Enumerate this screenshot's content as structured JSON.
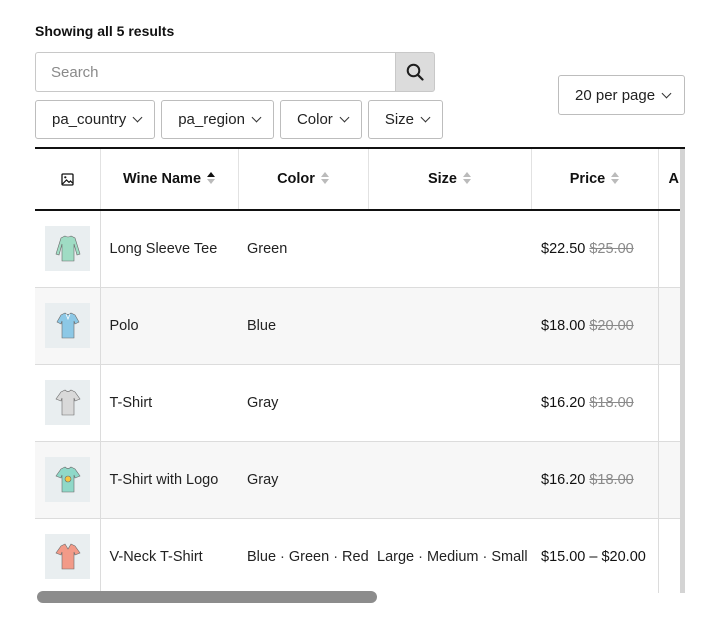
{
  "results_count": "Showing all 5 results",
  "search": {
    "placeholder": "Search",
    "value": ""
  },
  "per_page": {
    "label": "20 per page"
  },
  "filters": [
    {
      "label": "pa_country"
    },
    {
      "label": "pa_region"
    },
    {
      "label": "Color"
    },
    {
      "label": "Size"
    }
  ],
  "table": {
    "columns": [
      {
        "label": "",
        "icon": "image-icon"
      },
      {
        "label": "Wine Name",
        "sort": "ascending"
      },
      {
        "label": "Color",
        "sort": "none"
      },
      {
        "label": "Size",
        "sort": "none"
      },
      {
        "label": "Price",
        "sort": "none"
      },
      {
        "label": "Ap"
      }
    ],
    "rows": [
      {
        "name": "Long Sleeve Tee",
        "color": [
          "Green"
        ],
        "size": [],
        "price": "$22.50",
        "price_old": "$25.00",
        "thumb_icon": "long-sleeve-tee-icon",
        "thumb_color": "#9fdcc4"
      },
      {
        "name": "Polo",
        "color": [
          "Blue"
        ],
        "size": [],
        "price": "$18.00",
        "price_old": "$20.00",
        "thumb_icon": "polo-icon",
        "thumb_color": "#8cc8e6"
      },
      {
        "name": "T-Shirt",
        "color": [
          "Gray"
        ],
        "size": [],
        "price": "$16.20",
        "price_old": "$18.00",
        "thumb_icon": "t-shirt-icon",
        "thumb_color": "#d9d9d9"
      },
      {
        "name": "T-Shirt with Logo",
        "color": [
          "Gray"
        ],
        "size": [],
        "price": "$16.20",
        "price_old": "$18.00",
        "thumb_icon": "t-shirt-logo-icon",
        "thumb_color": "#8fd8c8"
      },
      {
        "name": "V-Neck T-Shirt",
        "color": [
          "Blue",
          "Green",
          "Red"
        ],
        "size": [
          "Large",
          "Medium",
          "Small"
        ],
        "price": "$15.00 – $20.00",
        "price_old": "",
        "thumb_icon": "v-neck-tee-icon",
        "thumb_color": "#f29a88"
      }
    ]
  }
}
